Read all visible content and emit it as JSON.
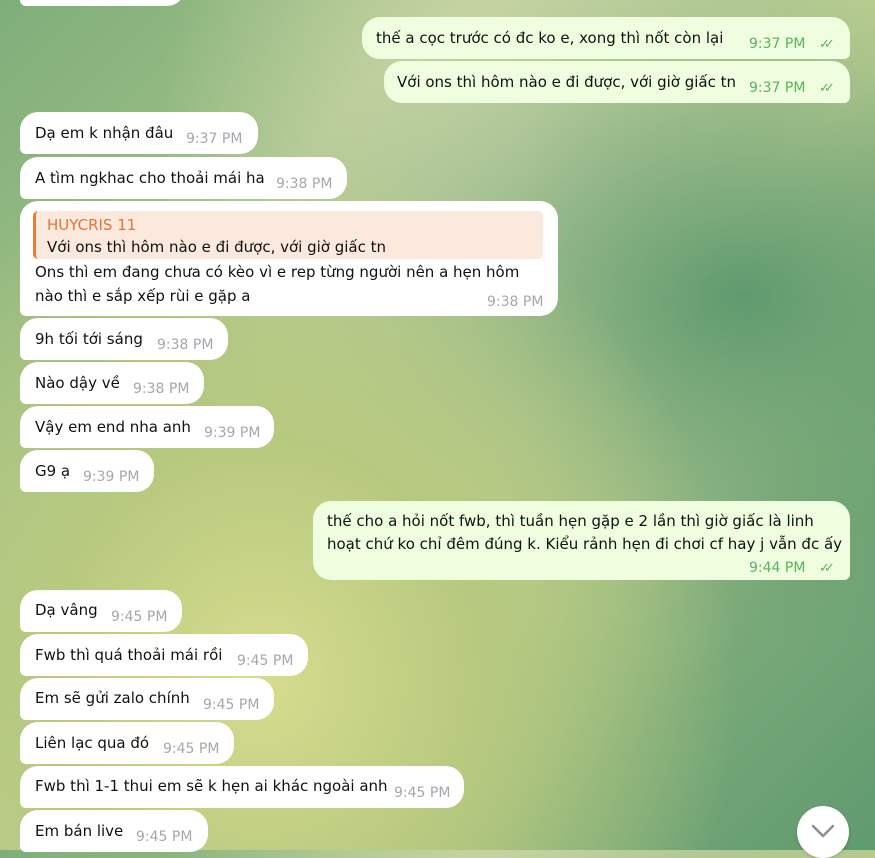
{
  "messages": [
    {
      "dir": "out",
      "text": "thế a cọc trước có đc ko e, xong thì nốt còn lại",
      "time": "9:37 PM"
    },
    {
      "dir": "out",
      "text": "Với ons thì hôm nào e đi được, với giờ giấc tn",
      "time": "9:37 PM"
    },
    {
      "dir": "in",
      "text": "Dạ em k nhận đâu",
      "time": "9:37 PM"
    },
    {
      "dir": "in",
      "text": "A tìm ngkhac cho thoải mái ha",
      "time": "9:38 PM"
    },
    {
      "dir": "in",
      "reply_name": "HUYCRIS 11",
      "reply_text": "Với ons thì hôm nào e đi được, với giờ giấc tn",
      "text_line1": "Ons thì em đang chưa có kèo vì e rep từng người nên a hẹn hôm",
      "text_line2": "nào thì e sắp xếp rùi e gặp a",
      "time": "9:38 PM"
    },
    {
      "dir": "in",
      "text": "9h tối tới sáng",
      "time": "9:38 PM"
    },
    {
      "dir": "in",
      "text": "Nào dậy về",
      "time": "9:38 PM"
    },
    {
      "dir": "in",
      "text": "Vậy em end nha anh",
      "time": "9:39 PM"
    },
    {
      "dir": "in",
      "text": "G9 ạ",
      "time": "9:39 PM"
    },
    {
      "dir": "out",
      "text_line1": "thế cho a hỏi nốt fwb, thì tuần hẹn gặp e 2 lần thì giờ giấc là linh",
      "text_line2": "hoạt chứ ko chỉ đêm đúng k. Kiểu rảnh hẹn đi chơi cf hay j vẫn đc ấy",
      "time": "9:44 PM"
    },
    {
      "dir": "in",
      "text": "Dạ vâng",
      "time": "9:45 PM"
    },
    {
      "dir": "in",
      "text": "Fwb thì quá thoải mái rồi",
      "time": "9:45 PM"
    },
    {
      "dir": "in",
      "text": "Em sẽ gửi zalo chính",
      "time": "9:45 PM"
    },
    {
      "dir": "in",
      "text": "Liên lạc qua đó",
      "time": "9:45 PM"
    },
    {
      "dir": "in",
      "text": "Fwb thì 1-1 thui em sẽ k hẹn ai khác ngoài anh",
      "time": "9:45 PM"
    },
    {
      "dir": "in",
      "text": "Em bán live",
      "time": "9:45 PM"
    }
  ],
  "read_check": "✓✓",
  "icons": {
    "scroll_down": "chevron-down-icon"
  }
}
